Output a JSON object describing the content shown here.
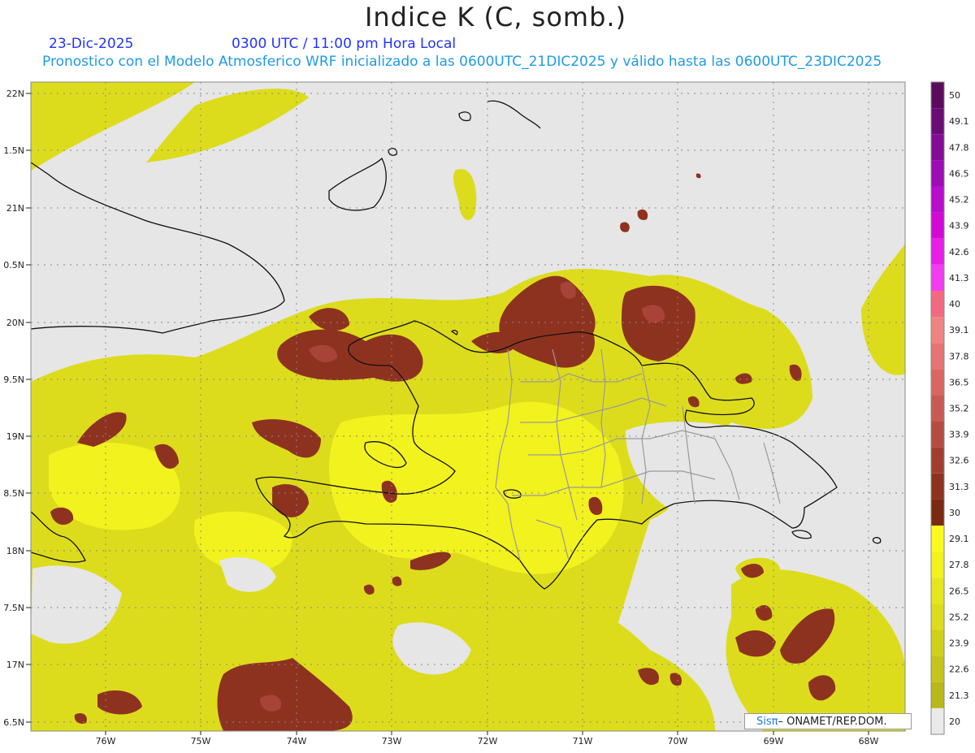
{
  "title": "Indice K (C, somb.)",
  "date": "23-Dic-2025",
  "time": "0300 UTC / 11:00 pm Hora Local",
  "description": "Pronostico con el Modelo Atmosferico WRF inicializado a las 0600UTC_21DIC2025 y válido hasta las  0600UTC_23DIC2025",
  "credit": {
    "brand": "SisTT",
    "org": "– ONAMET/REP.DOM."
  },
  "lat_labels": [
    "22N",
    "1.5N",
    "21N",
    "0.5N",
    "20N",
    "9.5N",
    "19N",
    "8.5N",
    "18N",
    "7.5N",
    "17N",
    "6.5N"
  ],
  "lon_labels": [
    "76W",
    "75W",
    "74W",
    "73W",
    "72W",
    "71W",
    "70W",
    "69W",
    "68W"
  ],
  "colorbar": [
    {
      "label": "50",
      "color": "#5c0a5c"
    },
    {
      "label": "49.1",
      "color": "#6b0b75"
    },
    {
      "label": "47.8",
      "color": "#840b96"
    },
    {
      "label": "46.5",
      "color": "#9d0cb4"
    },
    {
      "label": "45.2",
      "color": "#b80dcc"
    },
    {
      "label": "43.9",
      "color": "#d20ad6"
    },
    {
      "label": "42.6",
      "color": "#e61ee6"
    },
    {
      "label": "41.3",
      "color": "#f23cf0"
    },
    {
      "label": "40",
      "color": "#f26a82"
    },
    {
      "label": "39.1",
      "color": "#ee8482"
    },
    {
      "label": "37.8",
      "color": "#e67472"
    },
    {
      "label": "36.5",
      "color": "#da6664"
    },
    {
      "label": "35.2",
      "color": "#c85a54"
    },
    {
      "label": "33.9",
      "color": "#b44c42"
    },
    {
      "label": "32.6",
      "color": "#a03e30"
    },
    {
      "label": "31.3",
      "color": "#8e3220"
    },
    {
      "label": "30",
      "color": "#7a2a10"
    },
    {
      "label": "29.1",
      "color": "#fafa1e"
    },
    {
      "label": "27.8",
      "color": "#f2f21e"
    },
    {
      "label": "26.5",
      "color": "#e6e61c"
    },
    {
      "label": "25.2",
      "color": "#dcdc1c"
    },
    {
      "label": "23.9",
      "color": "#d0d01a"
    },
    {
      "label": "22.6",
      "color": "#c4c41a"
    },
    {
      "label": "21.3",
      "color": "#b8b818"
    },
    {
      "label": "20",
      "color": "#eaeaea"
    }
  ],
  "colors": {
    "background": "#e6e6e6",
    "coast": "#111111",
    "provinces": "#9a9a9a",
    "grid": "#888888"
  }
}
